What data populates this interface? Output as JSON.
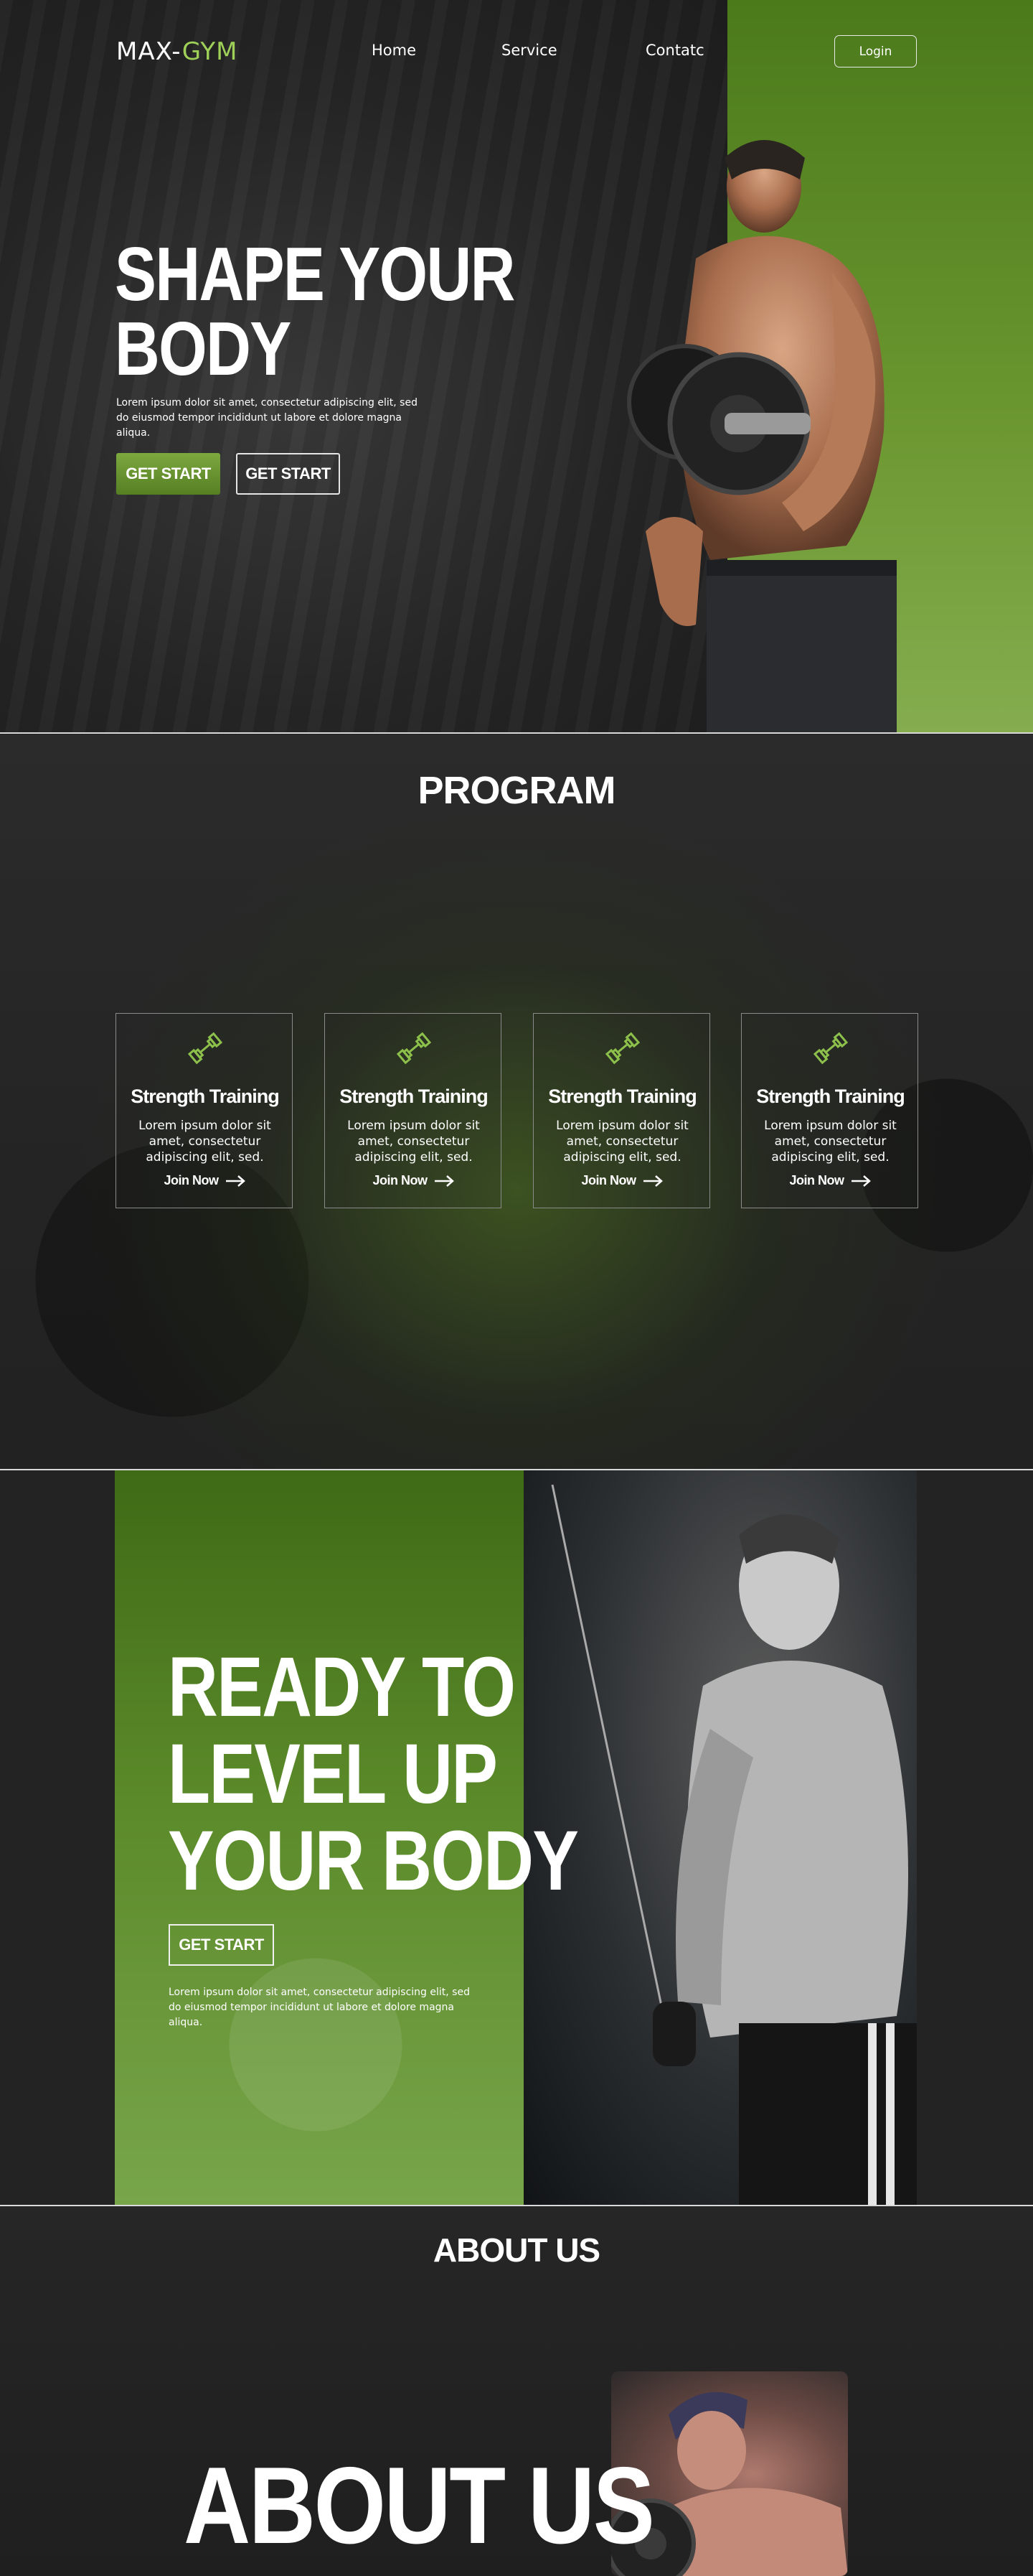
{
  "nav": {
    "logo_main": "MAX-",
    "logo_accent": "GYM",
    "links": [
      "Home",
      "Service",
      "Contatc"
    ],
    "login_label": "Login"
  },
  "hero": {
    "title_line1": "SHAPE YOUR",
    "title_line2": "BODY",
    "text": "Lorem ipsum dolor sit amet, consectetur adipiscing elit, sed do eiusmod tempor incididunt ut labore et dolore magna aliqua.",
    "primary_button": "GET START",
    "secondary_button": "GET START"
  },
  "program": {
    "title": "PROGRAM",
    "cards": [
      {
        "title": "Strength Training",
        "text": "Lorem ipsum dolor sit amet, consectetur adipiscing elit, sed.",
        "link": "Join Now"
      },
      {
        "title": "Strength Training",
        "text": "Lorem ipsum dolor sit amet, consectetur adipiscing elit, sed.",
        "link": "Join Now"
      },
      {
        "title": "Strength Training",
        "text": "Lorem ipsum dolor sit amet, consectetur adipiscing elit, sed.",
        "link": "Join Now"
      },
      {
        "title": "Strength Training",
        "text": "Lorem ipsum dolor sit amet, consectetur adipiscing elit, sed.",
        "link": "Join Now"
      }
    ],
    "card_icon": "dumbbell-icon",
    "link_icon": "arrow-right-icon"
  },
  "ready": {
    "title_line1": "READY TO",
    "title_line2": "LEVEL UP",
    "title_line3": "YOUR BODY",
    "button": "GET START",
    "text": "Lorem ipsum dolor sit amet, consectetur adipiscing elit, sed do eiusmod tempor incididunt ut labore et dolore magna aliqua."
  },
  "about": {
    "title": "ABOUT US",
    "big_title": "ABOUT US"
  },
  "colors": {
    "accent": "#9fd158",
    "green_dark": "#4b7a1b",
    "green_light": "#85ad4f",
    "background": "#232323"
  }
}
